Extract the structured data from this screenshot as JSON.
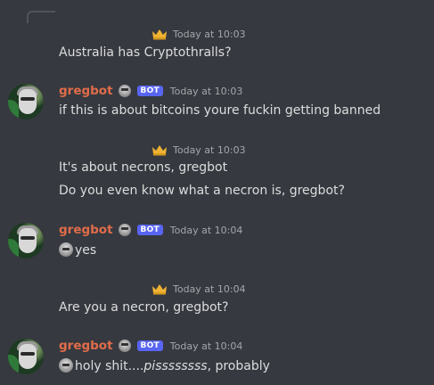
{
  "messages": [
    {
      "kind": "continuation",
      "timestamp": "Today at 10:03",
      "lines": [
        "Australia has Cryptothralls?"
      ]
    },
    {
      "kind": "bot",
      "author": "gregbot",
      "badge": "BOT",
      "timestamp": "Today at 10:03",
      "lines": [
        "if this is about bitcoins youre fuckin getting banned"
      ]
    },
    {
      "kind": "continuation",
      "timestamp": "Today at 10:03",
      "lines": [
        "It's about necrons, gregbot",
        "Do you even know what a necron is, gregbot?"
      ]
    },
    {
      "kind": "bot",
      "author": "gregbot",
      "badge": "BOT",
      "timestamp": "Today at 10:04",
      "lines": [
        "yes"
      ]
    },
    {
      "kind": "continuation",
      "timestamp": "Today at 10:04",
      "lines": [
        "Are you a necron, gregbot?"
      ]
    },
    {
      "kind": "bot",
      "author": "gregbot",
      "badge": "BOT",
      "timestamp": "Today at 10:04",
      "lines": [
        "holy shit....",
        "pissssssss",
        ", probably"
      ]
    }
  ],
  "colors": {
    "background": "#36393f",
    "username": "#e06c4a",
    "bot_badge": "#5865f2",
    "text": "#dcddde",
    "timestamp": "#a3a6aa"
  },
  "icons": {
    "crown": "crown-icon",
    "avatar": "gregbot-avatar",
    "emoji": "greg-face-emoji"
  }
}
